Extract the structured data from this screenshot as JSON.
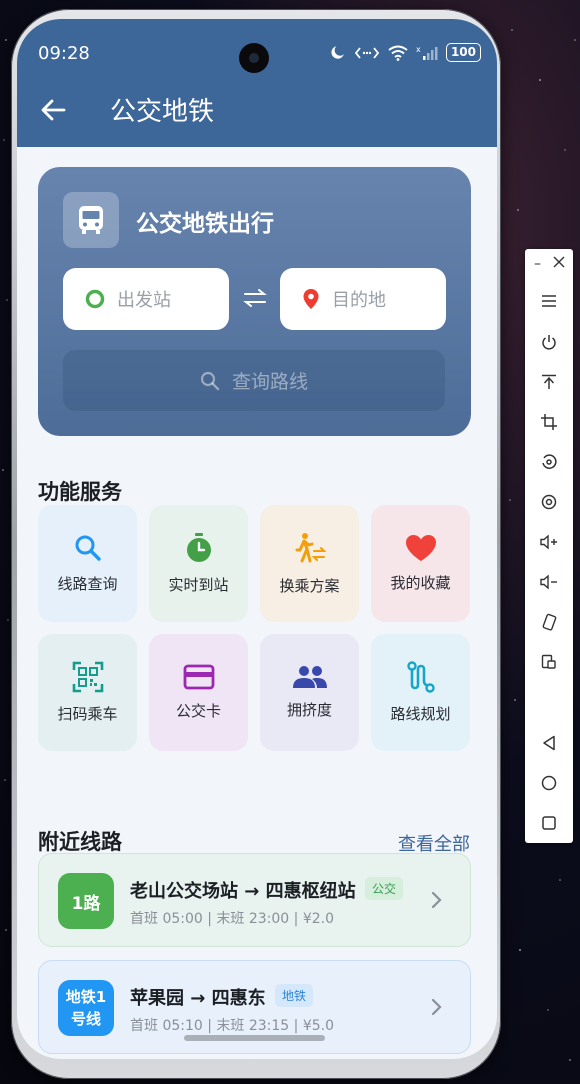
{
  "status_bar": {
    "time": "09:28",
    "battery": "100",
    "icons": [
      "moon-icon",
      "data-transfer-icon",
      "wifi-icon",
      "signal-icon",
      "battery-icon"
    ]
  },
  "app_bar": {
    "title": "公交地铁",
    "back_icon": "arrow-left-icon"
  },
  "hero": {
    "icon": "bus-icon",
    "title": "公交地铁出行",
    "origin_placeholder": "出发站",
    "destination_placeholder": "目的地",
    "swap_icon": "swap-arrows-icon",
    "query_label": "查询路线"
  },
  "services": {
    "title": "功能服务",
    "items": [
      {
        "label": "线路查询",
        "icon": "search-icon",
        "color": "#2196f3",
        "bg": "#e6f0fa"
      },
      {
        "label": "实时到站",
        "icon": "stopwatch-icon",
        "color": "#43a047",
        "bg": "#e8f2ec"
      },
      {
        "label": "换乘方案",
        "icon": "transfer-walk-icon",
        "color": "#f59e0b",
        "bg": "#f8efe4"
      },
      {
        "label": "我的收藏",
        "icon": "heart-icon",
        "color": "#f0413a",
        "bg": "#f6e6ea"
      },
      {
        "label": "扫码乘车",
        "icon": "qr-scan-icon",
        "color": "#169c8c",
        "bg": "#e4eff1"
      },
      {
        "label": "公交卡",
        "icon": "card-icon",
        "color": "#9c27b0",
        "bg": "#efe5f5"
      },
      {
        "label": "拥挤度",
        "icon": "people-icon",
        "color": "#3949ab",
        "bg": "#e8e9f5"
      },
      {
        "label": "路线规划",
        "icon": "route-icon",
        "color": "#17a6c8",
        "bg": "#e3f2f8"
      }
    ]
  },
  "nearby": {
    "title": "附近线路",
    "view_all": "查看全部",
    "routes": [
      {
        "badge": "1路",
        "name": "老山公交场站 → 四惠枢纽站",
        "type": "公交",
        "schedule": "首班 05:00 | 末班 23:00 | ¥2.0",
        "badge_color": "#4caf50",
        "card_bg": "#e8f3ef",
        "card_border": "#cfe5d8",
        "tag_bg": "#d6efdc",
        "tag_color": "#3b9a54"
      },
      {
        "badge": "地铁1号线",
        "name": "苹果园 → 四惠东",
        "type": "地铁",
        "schedule": "首班 05:10 | 末班 23:15 | ¥5.0",
        "badge_color": "#2196f3",
        "card_bg": "#e7f0fb",
        "card_border": "#c8dcf2",
        "tag_bg": "#d5e8fb",
        "tag_color": "#2b85d8"
      }
    ]
  },
  "colors": {
    "primary": "#3d6699",
    "hero_card": "#5a79a4",
    "screen_bg": "#f2f5fa"
  },
  "emulator_sidebar": {
    "items": [
      "minimize-icon",
      "close-icon",
      "menu-icon",
      "power-icon",
      "pin-top-icon",
      "crop-icon",
      "rotate-icon",
      "record-icon",
      "volume-up-icon",
      "volume-down-icon",
      "rotate-device-icon",
      "screenshot-icon",
      "nav-back-icon",
      "nav-home-icon",
      "nav-recents-icon"
    ]
  }
}
